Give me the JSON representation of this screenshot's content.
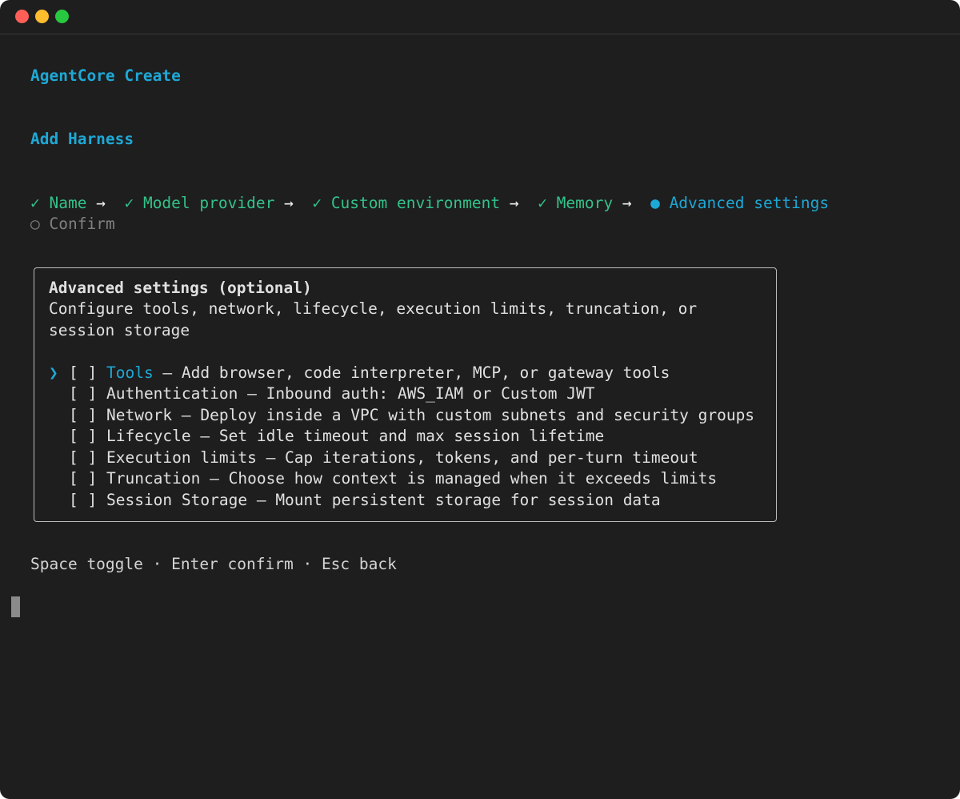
{
  "window": {
    "buttons": [
      "close",
      "minimize",
      "maximize"
    ]
  },
  "app_title": "AgentCore Create",
  "screen_title": "Add Harness",
  "steps": [
    {
      "label": "Name",
      "state": "done",
      "marker": "✓"
    },
    {
      "label": "Model provider",
      "state": "done",
      "marker": "✓"
    },
    {
      "label": "Custom environment",
      "state": "done",
      "marker": "✓"
    },
    {
      "label": "Memory",
      "state": "done",
      "marker": "✓"
    },
    {
      "label": "Advanced settings",
      "state": "current",
      "marker": "●"
    },
    {
      "label": "Confirm",
      "state": "pending",
      "marker": "○"
    }
  ],
  "step_separator": "→",
  "panel": {
    "heading": "Advanced settings (optional)",
    "description_line1": "Configure tools, network, lifecycle, execution limits, truncation, or",
    "description_line2": "session storage",
    "pointer": "❯",
    "options": [
      {
        "checkbox": "[ ]",
        "name": "Tools",
        "description": " — Add browser, code interpreter, MCP, or gateway tools",
        "focused": true
      },
      {
        "checkbox": "[ ]",
        "name": "Authentication",
        "description": " — Inbound auth: AWS_IAM or Custom JWT",
        "focused": false
      },
      {
        "checkbox": "[ ]",
        "name": "Network",
        "description": " — Deploy inside a VPC with custom subnets and security groups",
        "focused": false
      },
      {
        "checkbox": "[ ]",
        "name": "Lifecycle",
        "description": " — Set idle timeout and max session lifetime",
        "focused": false
      },
      {
        "checkbox": "[ ]",
        "name": "Execution limits",
        "description": " — Cap iterations, tokens, and per-turn timeout",
        "focused": false
      },
      {
        "checkbox": "[ ]",
        "name": "Truncation",
        "description": " — Choose how context is managed when it exceeds limits",
        "focused": false
      },
      {
        "checkbox": "[ ]",
        "name": "Session Storage",
        "description": " — Mount persistent storage for session data",
        "focused": false
      }
    ]
  },
  "help_text": "Space toggle · Enter confirm · Esc back",
  "colors": {
    "background": "#1e1e1e",
    "accent": "#1ea8d6",
    "done": "#33c28a",
    "pending": "#808080"
  }
}
